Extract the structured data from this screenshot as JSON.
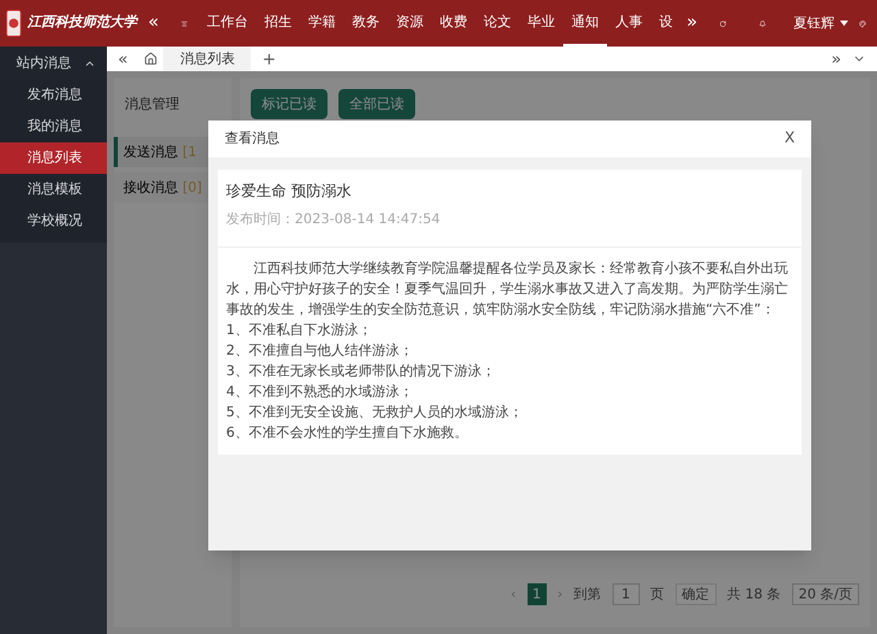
{
  "header": {
    "logo_text": "江西科技师范大学",
    "collapse": "«",
    "more": "»",
    "nav": [
      {
        "label": "工作台",
        "selected": false
      },
      {
        "label": "招生",
        "selected": false
      },
      {
        "label": "学籍",
        "selected": false
      },
      {
        "label": "教务",
        "selected": false
      },
      {
        "label": "资源",
        "selected": false
      },
      {
        "label": "收费",
        "selected": false
      },
      {
        "label": "论文",
        "selected": false
      },
      {
        "label": "毕业",
        "selected": false
      },
      {
        "label": "通知",
        "selected": true
      },
      {
        "label": "人事",
        "selected": false
      },
      {
        "label": "设",
        "selected": false
      }
    ],
    "user": "夏钰辉"
  },
  "sidebar": {
    "title": "站内消息",
    "items": [
      {
        "label": "发布消息",
        "selected": false
      },
      {
        "label": "我的消息",
        "selected": false
      },
      {
        "label": "消息列表",
        "selected": true
      },
      {
        "label": "消息模板",
        "selected": false
      },
      {
        "label": "学校概况",
        "selected": false
      }
    ]
  },
  "tab_bar": {
    "back": "«",
    "forward": "»",
    "tabs": [
      {
        "label": "消息列表",
        "selected": true
      }
    ],
    "add": "+"
  },
  "message_menu": {
    "title": "消息管理",
    "items": [
      {
        "label": "发送消息",
        "count": "[1",
        "selected": true
      },
      {
        "label": "接收消息",
        "count": "[0]",
        "selected": false
      }
    ]
  },
  "actions": [
    "标记已读",
    "全部已读"
  ],
  "pagination": {
    "prev": "‹",
    "pages": [
      {
        "label": "1",
        "selected": true
      }
    ],
    "next": "›",
    "goto_label": "到第",
    "goto_value": "1",
    "page_unit": "页",
    "confirm": "确定",
    "total": "共 18 条",
    "page_size": "20 条/页"
  },
  "dialog": {
    "title": "查看消息",
    "close": "X",
    "message": {
      "title": "珍爱生命 预防溺水",
      "date": "发布时间：2023-08-14 14:47:54",
      "paragraph": "江西科技师范大学继续教育学院温馨提醒各位学员及家长：经常教育小孩不要私自外出玩水，用心守护好孩子的安全！夏季气温回升，学生溺水事故又进入了高发期。为严防学生溺亡事故的发生，增强学生的安全防范意识，筑牢防溺水安全防线，牢记防溺水措施“六不准”：",
      "rules": [
        "1、不准私自下水游泳；",
        "2、不准擅自与他人结伴游泳；",
        "3、不准在无家长或老师带队的情况下游泳；",
        "4、不准到不熟悉的水域游泳；",
        "5、不准到无安全设施、无救护人员的水域游泳；",
        "6、不准不会水性的学生擅自下水施救。"
      ]
    }
  }
}
